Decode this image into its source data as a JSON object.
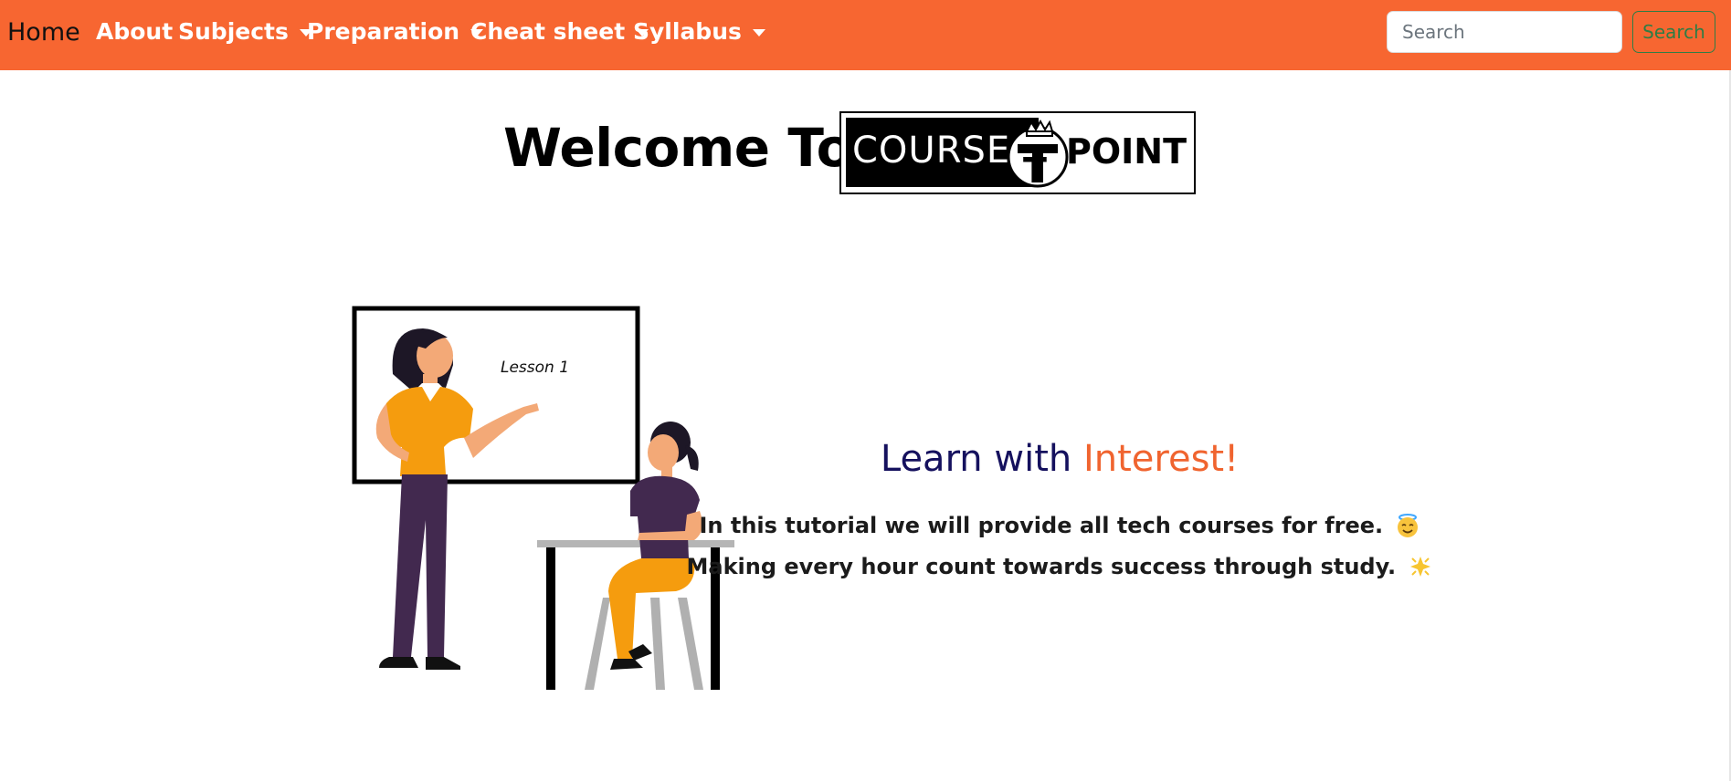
{
  "navbar": {
    "brand": "Home",
    "items": [
      {
        "label": "About",
        "has_dropdown": false
      },
      {
        "label": "Subjects",
        "has_dropdown": true
      },
      {
        "label": "Preparation",
        "has_dropdown": true
      },
      {
        "label": "Cheat sheet",
        "has_dropdown": true
      },
      {
        "label": "Syllabus",
        "has_dropdown": true
      }
    ],
    "search": {
      "placeholder": "Search",
      "value": "",
      "button_label": "Search"
    }
  },
  "hero": {
    "welcome": "Welcome To",
    "logo": {
      "left_text": "COURSE",
      "right_text": "POINT",
      "emblem_letter": "T"
    }
  },
  "illustration": {
    "board_text": "Lesson 1"
  },
  "tagline": {
    "part1": "Learn with ",
    "part2": "Interest!",
    "line1": "In this tutorial we will provide all tech courses for free.",
    "line1_emoji": "smiling-face-with-halo-icon",
    "line2": "Making every hour count towards success through study.",
    "line2_emoji": "glowing-star-icon"
  },
  "colors": {
    "navbar_bg": "#f76631",
    "accent_orange": "#f0642f",
    "navy": "#15115e",
    "search_button_green": "#2f7d45"
  }
}
